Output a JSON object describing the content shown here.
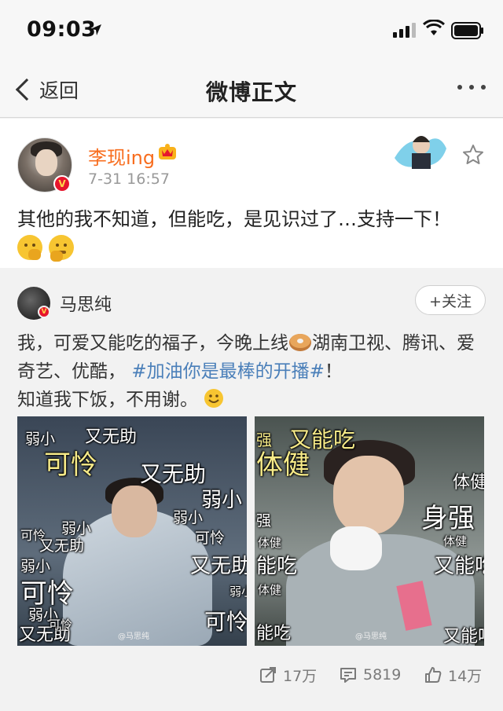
{
  "status_bar": {
    "time": "09:03"
  },
  "nav": {
    "back_label": "返回",
    "title": "微博正文"
  },
  "post": {
    "author": "李现ing",
    "time": "7-31 16:57",
    "text": "其他的我不知道，但能吃，是见识过了…支持一下！",
    "emojis": [
      "thinking-emoji",
      "shy-emoji"
    ]
  },
  "repost": {
    "author": "马思纯",
    "follow_label": "+关注",
    "text_part1": "我，可爱又能吃的福子，今晚上线",
    "text_part2": "湖南卫视、腾讯、爱奇艺、优酷，",
    "hashtag": "#加油你是最棒的开播#",
    "text_part3": "！",
    "text_line3": "知道我下饭，不用谢。",
    "image1_captions": [
      "弱小",
      "又无助",
      "可怜",
      "又无助",
      "弱小",
      "弱小",
      "可怜",
      "弱小",
      "又无助",
      "可怜",
      "弱小",
      "又无助",
      "可怜",
      "弱小",
      "弱小",
      "又无助",
      "可怜",
      "可怜"
    ],
    "image2_captions": [
      "强",
      "又能吃",
      "体健",
      "体健",
      "身强",
      "强",
      "体健",
      "体健",
      "能吃",
      "又能吃",
      "体健",
      "能吃",
      "又能吃"
    ],
    "watermark": "@马思纯"
  },
  "actions": {
    "repost_count": "17万",
    "comment_count": "5819",
    "like_count": "14万"
  },
  "colors": {
    "author_orange": "#f86d1e",
    "hashtag_blue": "#4a7fb9",
    "verified_red": "#e6162d"
  }
}
